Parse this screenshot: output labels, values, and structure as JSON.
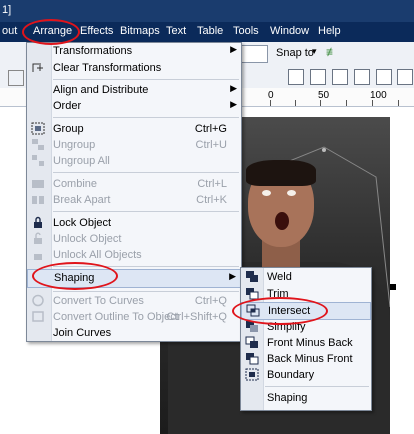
{
  "title_fragment": "1]",
  "menubar": {
    "items": [
      "out",
      "Arrange",
      "Effects",
      "Bitmaps",
      "Text",
      "Table",
      "Tools",
      "Window",
      "Help"
    ]
  },
  "toolbar": {
    "snap_label": "Snap to"
  },
  "ruler": {
    "labels": [
      "0",
      "50",
      "100"
    ]
  },
  "arrange_menu": {
    "items": [
      {
        "label": "Transformations",
        "shortcut": "",
        "submenu": true,
        "disabled": false,
        "icon": ""
      },
      {
        "label": "Clear Transformations",
        "shortcut": "",
        "submenu": false,
        "disabled": false,
        "icon": "clear-transform-icon"
      },
      {
        "label": "Align and Distribute",
        "shortcut": "",
        "submenu": true,
        "disabled": false,
        "icon": ""
      },
      {
        "label": "Order",
        "shortcut": "",
        "submenu": true,
        "disabled": false,
        "icon": ""
      },
      {
        "label": "Group",
        "shortcut": "Ctrl+G",
        "submenu": false,
        "disabled": false,
        "icon": "group-icon"
      },
      {
        "label": "Ungroup",
        "shortcut": "Ctrl+U",
        "submenu": false,
        "disabled": true,
        "icon": "ungroup-icon"
      },
      {
        "label": "Ungroup All",
        "shortcut": "",
        "submenu": false,
        "disabled": true,
        "icon": "ungroup-all-icon"
      },
      {
        "label": "Combine",
        "shortcut": "Ctrl+L",
        "submenu": false,
        "disabled": true,
        "icon": "combine-icon"
      },
      {
        "label": "Break Apart",
        "shortcut": "Ctrl+K",
        "submenu": false,
        "disabled": true,
        "icon": "break-apart-icon"
      },
      {
        "label": "Lock Object",
        "shortcut": "",
        "submenu": false,
        "disabled": false,
        "icon": "lock-icon"
      },
      {
        "label": "Unlock Object",
        "shortcut": "",
        "submenu": false,
        "disabled": true,
        "icon": "unlock-icon"
      },
      {
        "label": "Unlock All Objects",
        "shortcut": "",
        "submenu": false,
        "disabled": true,
        "icon": "unlock-all-icon"
      },
      {
        "label": "Shaping",
        "shortcut": "",
        "submenu": true,
        "disabled": false,
        "icon": ""
      },
      {
        "label": "Convert To Curves",
        "shortcut": "Ctrl+Q",
        "submenu": false,
        "disabled": true,
        "icon": "convert-curves-icon"
      },
      {
        "label": "Convert Outline To Object",
        "shortcut": "Ctrl+Shift+Q",
        "submenu": false,
        "disabled": true,
        "icon": "convert-outline-icon"
      },
      {
        "label": "Join Curves",
        "shortcut": "",
        "submenu": false,
        "disabled": false,
        "icon": ""
      }
    ]
  },
  "shaping_menu": {
    "items": [
      {
        "label": "Weld",
        "icon": "weld-icon"
      },
      {
        "label": "Trim",
        "icon": "trim-icon"
      },
      {
        "label": "Intersect",
        "icon": "intersect-icon"
      },
      {
        "label": "Simplify",
        "icon": "simplify-icon"
      },
      {
        "label": "Front Minus Back",
        "icon": "front-minus-back-icon"
      },
      {
        "label": "Back Minus Front",
        "icon": "back-minus-front-icon"
      },
      {
        "label": "Boundary",
        "icon": "boundary-icon"
      },
      {
        "label": "Shaping",
        "icon": ""
      }
    ]
  },
  "colors": {
    "highlight_circle": "#e0141b",
    "menubar_bg": "#0b2a5a"
  }
}
